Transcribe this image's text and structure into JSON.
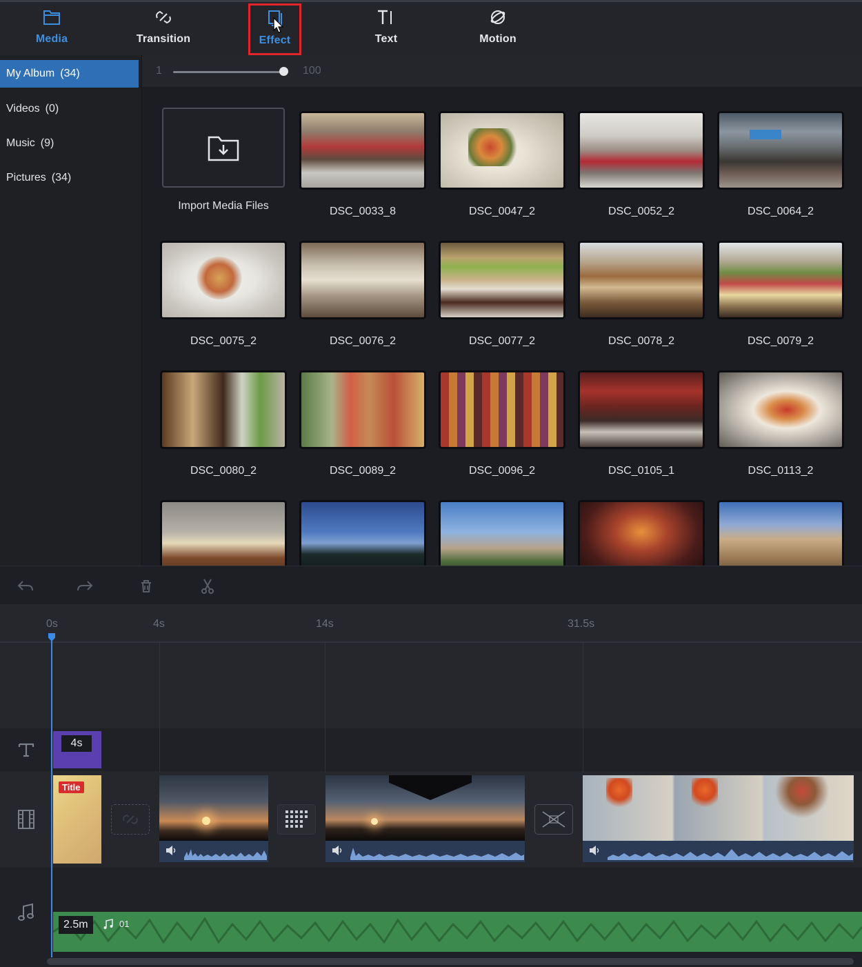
{
  "toolbar": {
    "tabs": [
      {
        "label": "Media",
        "icon": "folder-icon",
        "active": true
      },
      {
        "label": "Transition",
        "icon": "transition-icon"
      },
      {
        "label": "Effect",
        "icon": "effect-icon",
        "highlighted": true
      },
      {
        "label": "Text",
        "icon": "text-icon"
      },
      {
        "label": "Motion",
        "icon": "motion-icon"
      }
    ]
  },
  "sidebar": {
    "items": [
      {
        "label": "My Album",
        "count": "(34)",
        "active": true
      },
      {
        "label": "Videos",
        "count": "(0)"
      },
      {
        "label": "Music",
        "count": "(9)"
      },
      {
        "label": "Pictures",
        "count": "(34)"
      }
    ]
  },
  "zoom": {
    "min": "1",
    "max": "100",
    "level": 1.0
  },
  "library": {
    "import_label": "Import Media Files",
    "items": [
      "DSC_0033_8",
      "DSC_0047_2",
      "DSC_0052_2",
      "DSC_0064_2",
      "DSC_0075_2",
      "DSC_0076_2",
      "DSC_0077_2",
      "DSC_0078_2",
      "DSC_0079_2",
      "DSC_0080_2",
      "DSC_0089_2",
      "DSC_0096_2",
      "DSC_0105_1",
      "DSC_0113_2"
    ]
  },
  "timeline": {
    "ticks": [
      "0s",
      "4s",
      "14s",
      "31.5s"
    ],
    "title_clip": {
      "duration": "4s",
      "tag": "Title"
    },
    "music_clip": {
      "duration": "2.5m",
      "name": "01"
    }
  },
  "colors": {
    "accent": "#3f8fe0",
    "highlight_border": "#e0262a",
    "title_clip": "#5a3fb0",
    "music_clip": "#3d8a4e",
    "audio_strip": "#2b3a55"
  }
}
